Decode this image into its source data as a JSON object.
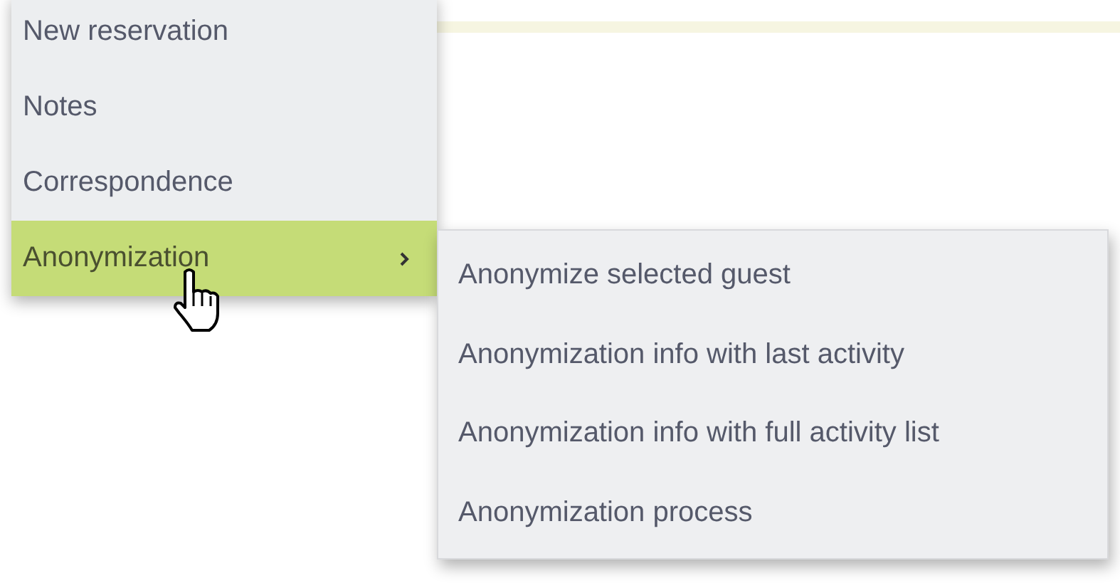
{
  "menu": {
    "items": [
      {
        "label": "New reservation",
        "selected": false,
        "has_submenu": false
      },
      {
        "label": "Notes",
        "selected": false,
        "has_submenu": false
      },
      {
        "label": "Correspondence",
        "selected": false,
        "has_submenu": false
      },
      {
        "label": "Anonymization",
        "selected": true,
        "has_submenu": true
      }
    ]
  },
  "submenu": {
    "items": [
      {
        "label": "Anonymize selected guest"
      },
      {
        "label": "Anonymization info with last activity"
      },
      {
        "label": "Anonymization info with full activity list"
      },
      {
        "label": "Anonymization process"
      }
    ]
  }
}
